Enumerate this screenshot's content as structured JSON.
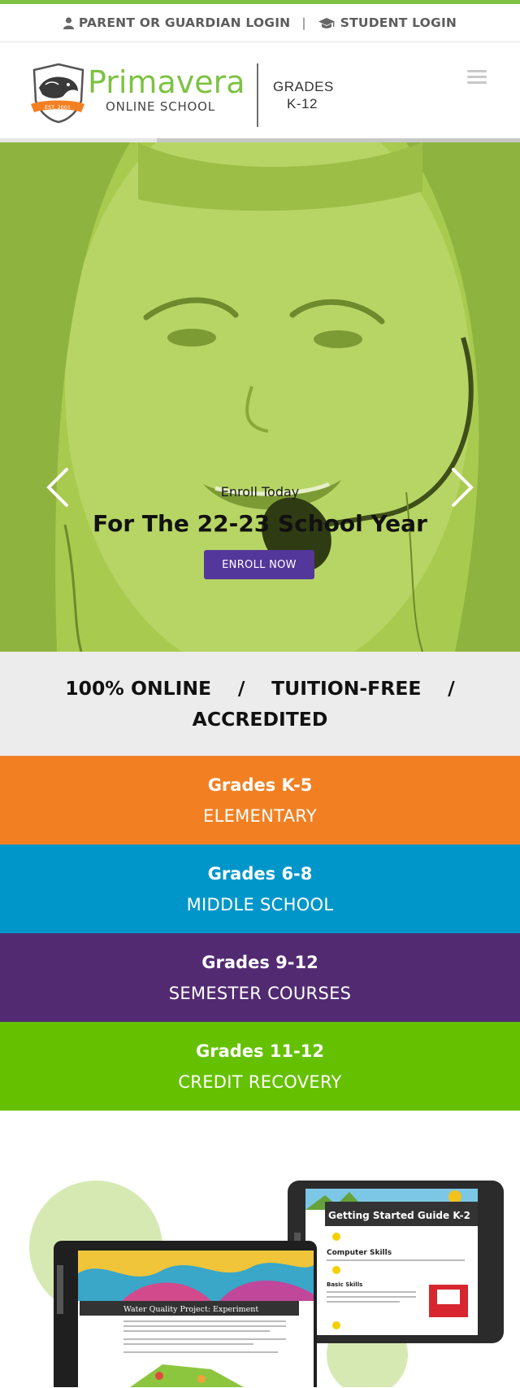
{
  "colors": {
    "accent_green": "#7dc242",
    "hero_overlay": "#a6c94a",
    "enroll_button": "#54379a",
    "elementary": "#f28022",
    "middle_school": "#0096ca",
    "semester": "#522a72",
    "credit_recovery": "#65c100"
  },
  "utility_nav": {
    "parent_login": "PARENT OR GUARDIAN LOGIN",
    "separator": "|",
    "student_login": "STUDENT LOGIN",
    "parent_icon": "user-icon",
    "student_icon": "graduation-cap-icon"
  },
  "header": {
    "logo_name": "Primavera",
    "logo_sub": "ONLINE SCHOOL",
    "logo_badge": "EST. 2001",
    "grades_line1": "GRADES",
    "grades_line2": "K-12",
    "menu_icon": "hamburger-menu-icon"
  },
  "hero": {
    "eyebrow": "Enroll Today",
    "title": "For The 22-23 School Year",
    "button_label": "ENROLL NOW",
    "prev_icon": "chevron-left-icon",
    "next_icon": "chevron-right-icon"
  },
  "tagline": {
    "text": "100% ONLINE    /    TUITION-FREE    /    ACCREDITED"
  },
  "grade_bands": [
    {
      "title": "Grades K-5",
      "subtitle": "ELEMENTARY"
    },
    {
      "title": "Grades 6-8",
      "subtitle": "MIDDLE SCHOOL"
    },
    {
      "title": "Grades 9-12",
      "subtitle": "SEMESTER COURSES"
    },
    {
      "title": "Grades 11-12",
      "subtitle": "CREDIT RECOVERY"
    }
  ],
  "promo": {
    "tablet_heading": "Getting Started Guide K-2",
    "tablet_section1": "Computer Skills",
    "tablet_section2": "Basic Skills",
    "laptop_heading": "Water Quality Project: Experiment"
  }
}
